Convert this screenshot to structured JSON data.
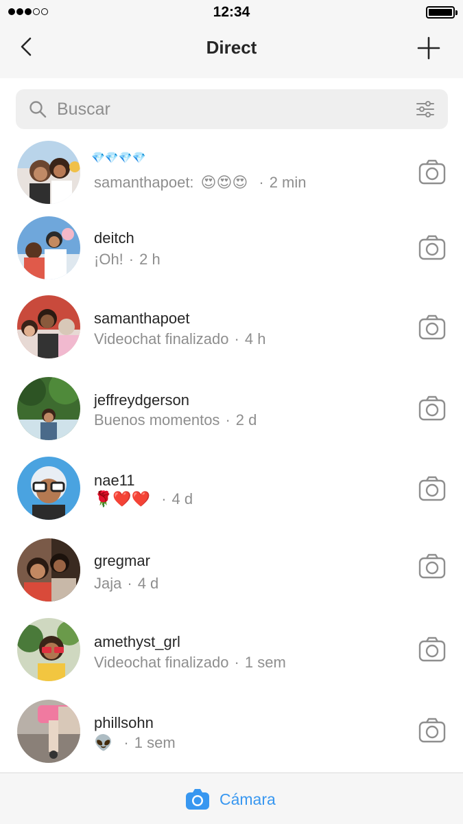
{
  "status_bar": {
    "time": "12:34",
    "signal_bars_filled": 3,
    "signal_bars_total": 5
  },
  "header": {
    "title": "Direct",
    "back_icon": "chevron-left-icon",
    "new_icon": "plus-icon"
  },
  "search": {
    "placeholder": "Buscar",
    "icon": "search-icon",
    "filter_icon": "filter-sliders-icon"
  },
  "conversations": [
    {
      "name_emoji": "💎💎💎💎",
      "sender": "samanthapoet:",
      "preview_emoji": "😍😍😍",
      "time": "2 min",
      "unread": false
    },
    {
      "name": "deitch",
      "preview": "¡Oh!",
      "time": "2 h"
    },
    {
      "name": "samanthapoet",
      "preview": "Videochat finalizado",
      "time": "4 h"
    },
    {
      "name": "jeffreydgerson",
      "preview": "Buenos momentos",
      "time": "2 d"
    },
    {
      "name": "nae11",
      "preview_emoji": "🌹❤️❤️",
      "time": "4 d"
    },
    {
      "name": "gregmar",
      "preview": "Jaja",
      "time": "4 d"
    },
    {
      "name": "amethyst_grl",
      "preview": "Videochat finalizado",
      "time": "1 sem"
    },
    {
      "name": "phillsohn",
      "preview_emoji": "👽",
      "time": "1 sem"
    }
  ],
  "bottom_bar": {
    "camera_label": "Cámara",
    "camera_icon": "camera-filled-icon"
  },
  "colors": {
    "accent": "#3897f0",
    "text_primary": "#262626",
    "text_secondary": "#8e8e8e",
    "bar_background": "#f6f6f6"
  },
  "separator": "·"
}
